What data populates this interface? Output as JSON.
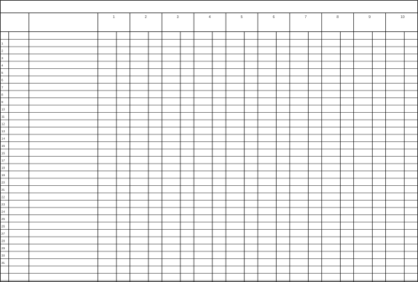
{
  "form": {
    "title": "",
    "column_groups": [
      "1",
      "2",
      "3",
      "4",
      "5",
      "6",
      "7",
      "8",
      "9",
      "10"
    ],
    "row_numbers": [
      "1",
      "2",
      "3",
      "4",
      "5",
      "6",
      "7",
      "8",
      "9",
      "10",
      "11",
      "12",
      "13",
      "14",
      "15",
      "16",
      "17",
      "18",
      "19",
      "20",
      "21",
      "22",
      "23",
      "24",
      "25",
      "26",
      "27",
      "28",
      "29",
      "30",
      "31"
    ],
    "blank_rows_after": 3
  }
}
